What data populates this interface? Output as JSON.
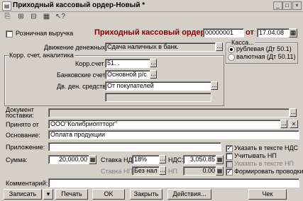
{
  "window": {
    "title": "Приходный кассовый ордер-Новый *",
    "minimize": "_",
    "maximize": "□",
    "close": "×"
  },
  "toolbar": {
    "icons": [
      "copy-icon",
      "new-icon",
      "filter-icon",
      "properties-icon",
      "help-cursor-icon"
    ]
  },
  "header": {
    "retail_label": "Розничная выручка",
    "order_title": "Приходный кассовый ордер №",
    "number": "00000001",
    "date_prefix": "от",
    "date": "17.04.08"
  },
  "kassa": {
    "legend": "Касса...",
    "options": [
      "рублевая (Дт 50.1)",
      "валютная (Дт 50.11)"
    ],
    "selected": 0
  },
  "movement": {
    "label": "Движение денежных средств",
    "value": "Сдача наличных в банк."
  },
  "corr_group": {
    "legend": "Корр. счет, аналитика",
    "account_label": "Корр.счет",
    "account_value": "51. .",
    "bank_label": "Банковские счета",
    "bank_value": "Основной р/с",
    "dds_label": "Дв. ден. средств",
    "dds_value": "От покупателей"
  },
  "document": {
    "label_line1": "Документ",
    "label_line2": "поставки:",
    "value": ""
  },
  "received_from": {
    "label": "Принято от",
    "value": "ООО\"Колибриоптторг\""
  },
  "basis": {
    "label": "Основание:",
    "value": "Оплата продукции"
  },
  "attachment": {
    "label": "Приложение:",
    "value": ""
  },
  "amount": {
    "label": "Сумма:",
    "value": "20,000.00"
  },
  "vat": {
    "rate_label": "Ставка НДС:",
    "rate_value": "18%",
    "label": "НДС:",
    "value": "3,050.85"
  },
  "np": {
    "rate_label": "Ставка НП:",
    "rate_value": "Без нал",
    "label": "НП",
    "value": "0.00"
  },
  "options": [
    {
      "label": "Указать в тексте НДС",
      "checked": true,
      "disabled": false
    },
    {
      "label": "Учитывать НП",
      "checked": false,
      "disabled": false
    },
    {
      "label": "Указать в тексте НП",
      "checked": false,
      "disabled": true
    },
    {
      "label": "Формировать проводки",
      "checked": true,
      "disabled": false
    }
  ],
  "comment": {
    "label": "Комментарий:",
    "value": ""
  },
  "buttons": {
    "save": "Записать",
    "print": "Печать",
    "ok": "OK",
    "close": "Закрыть",
    "actions": "Действия...",
    "receipt": "Чек"
  }
}
